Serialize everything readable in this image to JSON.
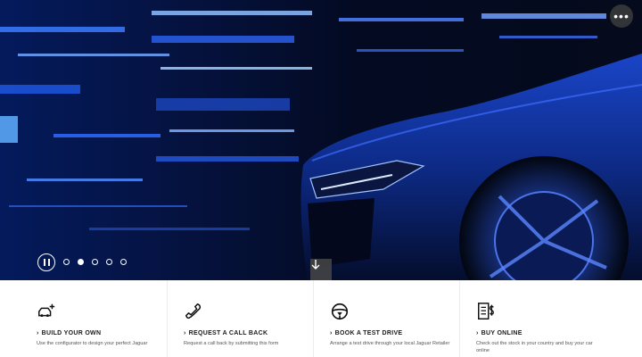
{
  "hero": {
    "more_label": "•••",
    "carousel": {
      "slide_count": 5,
      "active_index": 1
    }
  },
  "actions": [
    {
      "title": "BUILD YOUR OWN",
      "desc": "Use the configurator to design your perfect Jaguar",
      "icon": "car-plus-icon"
    },
    {
      "title": "REQUEST A CALL BACK",
      "desc": "Request a call back by submitting this form",
      "icon": "phone-icon"
    },
    {
      "title": "BOOK A TEST DRIVE",
      "desc": "Arrange a test drive through your local Jaguar Retailer",
      "icon": "steering-wheel-icon"
    },
    {
      "title": "BUY ONLINE",
      "desc": "Check out the stock in your country and buy your car online",
      "icon": "price-document-icon"
    }
  ],
  "colors": {
    "hero_dark": "#020716",
    "car_blue": "#0f2f8e",
    "accent_blue": "#1e5cff"
  }
}
